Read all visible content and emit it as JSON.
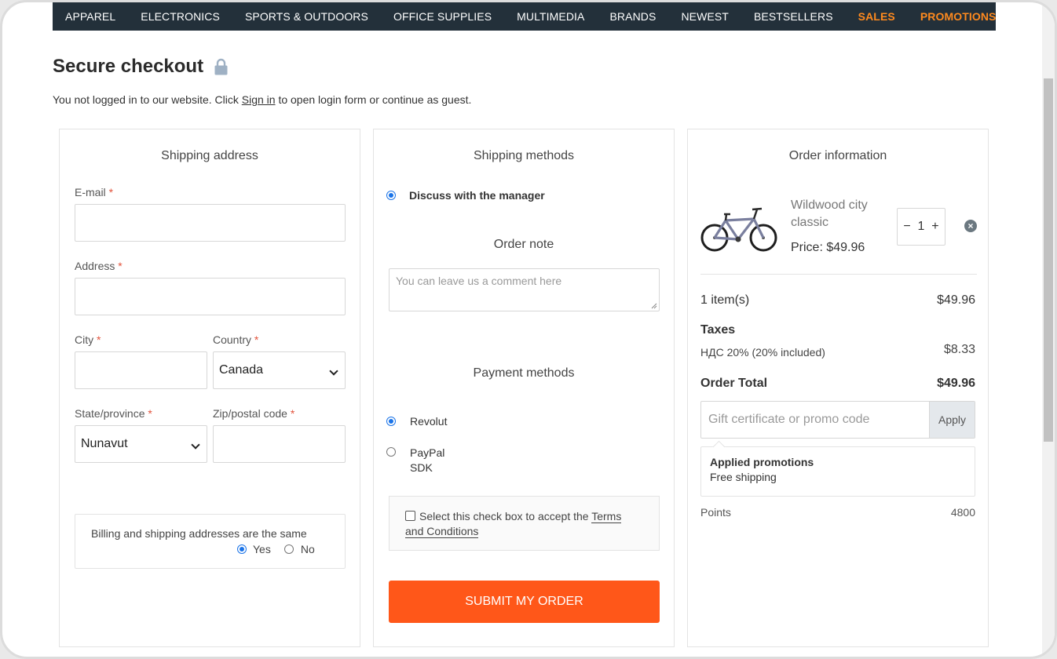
{
  "nav": {
    "items": [
      {
        "label": "APPAREL"
      },
      {
        "label": "ELECTRONICS"
      },
      {
        "label": "SPORTS & OUTDOORS"
      },
      {
        "label": "OFFICE SUPPLIES"
      },
      {
        "label": "MULTIMEDIA"
      },
      {
        "label": "BRANDS"
      },
      {
        "label": "NEWEST"
      },
      {
        "label": "BESTSELLERS"
      }
    ],
    "sales": "SALES",
    "promotions": "PROMOTIONS",
    "highlight_color": "#ff8a1e"
  },
  "page": {
    "title": "Secure checkout",
    "title_icon": "lock-icon",
    "notice_before": "You not logged in to our website. Click ",
    "notice_link": "Sign in",
    "notice_after": " to open login form or continue as guest."
  },
  "shipping_address": {
    "title": "Shipping address",
    "email_label": "E-mail",
    "address_label": "Address",
    "city_label": "City",
    "country_label": "Country",
    "country_value": "Canada",
    "state_label": "State/province",
    "state_value": "Nunavut",
    "zip_label": "Zip/postal code",
    "required_mark": "*",
    "billing_text": "Billing and shipping addresses are the same",
    "billing_yes": "Yes",
    "billing_no": "No"
  },
  "shipping_methods": {
    "title": "Shipping methods",
    "option": "Discuss with the manager",
    "note_title": "Order note",
    "note_placeholder": "You can leave us a comment here",
    "payment_title": "Payment methods",
    "payment_option_1": "Revolut",
    "payment_option_2_line1": "PayPal",
    "payment_option_2_line2": "SDK",
    "terms_text": "Select this check box to accept the ",
    "terms_link_1": "Terms",
    "terms_link_2": "and Conditions",
    "submit_label": "SUBMIT MY ORDER",
    "submit_color": "#ff5719"
  },
  "order": {
    "title": "Order information",
    "product_name_line1": "Wildwood city",
    "product_name_line2": "classic",
    "product_price": "Price: $49.96",
    "product_image": "bicycle-image",
    "qty_minus": "−",
    "qty_value": "1",
    "qty_plus": "+",
    "remove_icon": "close-circle-icon",
    "items_label": "1 item(s)",
    "items_value": "$49.96",
    "taxes_title": "Taxes",
    "tax_label": "НДС 20% (20% included)",
    "tax_value": "$8.33",
    "total_label": "Order Total",
    "total_value": "$49.96",
    "promo_placeholder": "Gift certificate or promo code",
    "apply_label": "Apply",
    "applied_title": "Applied promotions",
    "applied_item": "Free shipping",
    "points_label": "Points",
    "points_value": "4800"
  }
}
